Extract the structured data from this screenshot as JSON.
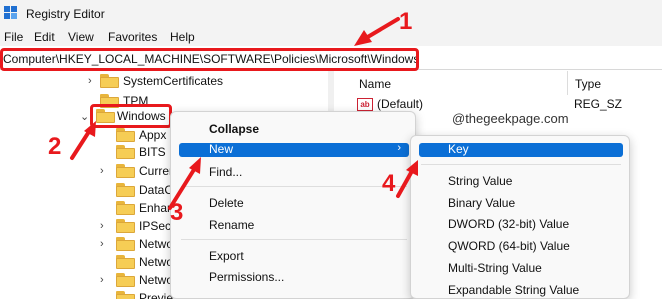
{
  "window": {
    "title": "Registry Editor"
  },
  "menu": [
    "File",
    "Edit",
    "View",
    "Favorites",
    "Help"
  ],
  "address": {
    "path": "Computer\\HKEY_LOCAL_MACHINE\\SOFTWARE\\Policies\\Microsoft\\Windows"
  },
  "tree": {
    "items": [
      {
        "label": "SystemCertificates",
        "expander": "›",
        "icon": "folder-icon"
      },
      {
        "label": "TPM",
        "expander": "",
        "icon": "folder-icon"
      },
      {
        "label": "Windows",
        "expander": "⌄",
        "icon": "folder-open-icon",
        "selected": true
      },
      {
        "label": "Appx",
        "expander": "",
        "icon": "folder-icon"
      },
      {
        "label": "BITS",
        "expander": "",
        "icon": "folder-icon"
      },
      {
        "label": "Curren",
        "expander": "›",
        "icon": "folder-icon"
      },
      {
        "label": "DataCo",
        "expander": "",
        "icon": "folder-icon"
      },
      {
        "label": "Enhanc",
        "expander": "",
        "icon": "folder-icon"
      },
      {
        "label": "IPSec",
        "expander": "›",
        "icon": "folder-icon"
      },
      {
        "label": "Netwo",
        "expander": "›",
        "icon": "folder-icon"
      },
      {
        "label": "Netwo",
        "expander": "",
        "icon": "folder-icon"
      },
      {
        "label": "Netwo",
        "expander": "›",
        "icon": "folder-icon"
      },
      {
        "label": "Previe",
        "expander": "",
        "icon": "folder-icon"
      }
    ]
  },
  "list": {
    "columns": {
      "name": "Name",
      "type": "Type"
    },
    "rows": [
      {
        "name": "(Default)",
        "type": "REG_SZ",
        "icon": "ab"
      }
    ]
  },
  "watermark": "@thegeekpage.com",
  "context_menu": {
    "items": [
      "Collapse",
      "New",
      "Find...",
      "Delete",
      "Rename",
      "Export",
      "Permissions..."
    ],
    "highlighted": "New",
    "submenu_arrow": "›"
  },
  "submenu": {
    "highlighted": "Key",
    "items": [
      "Key",
      "String Value",
      "Binary Value",
      "DWORD (32-bit) Value",
      "QWORD (64-bit) Value",
      "Multi-String Value",
      "Expandable String Value"
    ]
  },
  "annotations": {
    "steps": [
      "1",
      "2",
      "3",
      "4"
    ],
    "color": "#e8191d"
  },
  "colors": {
    "selection": "#0b6fd6",
    "folder": "#f6cd55"
  }
}
